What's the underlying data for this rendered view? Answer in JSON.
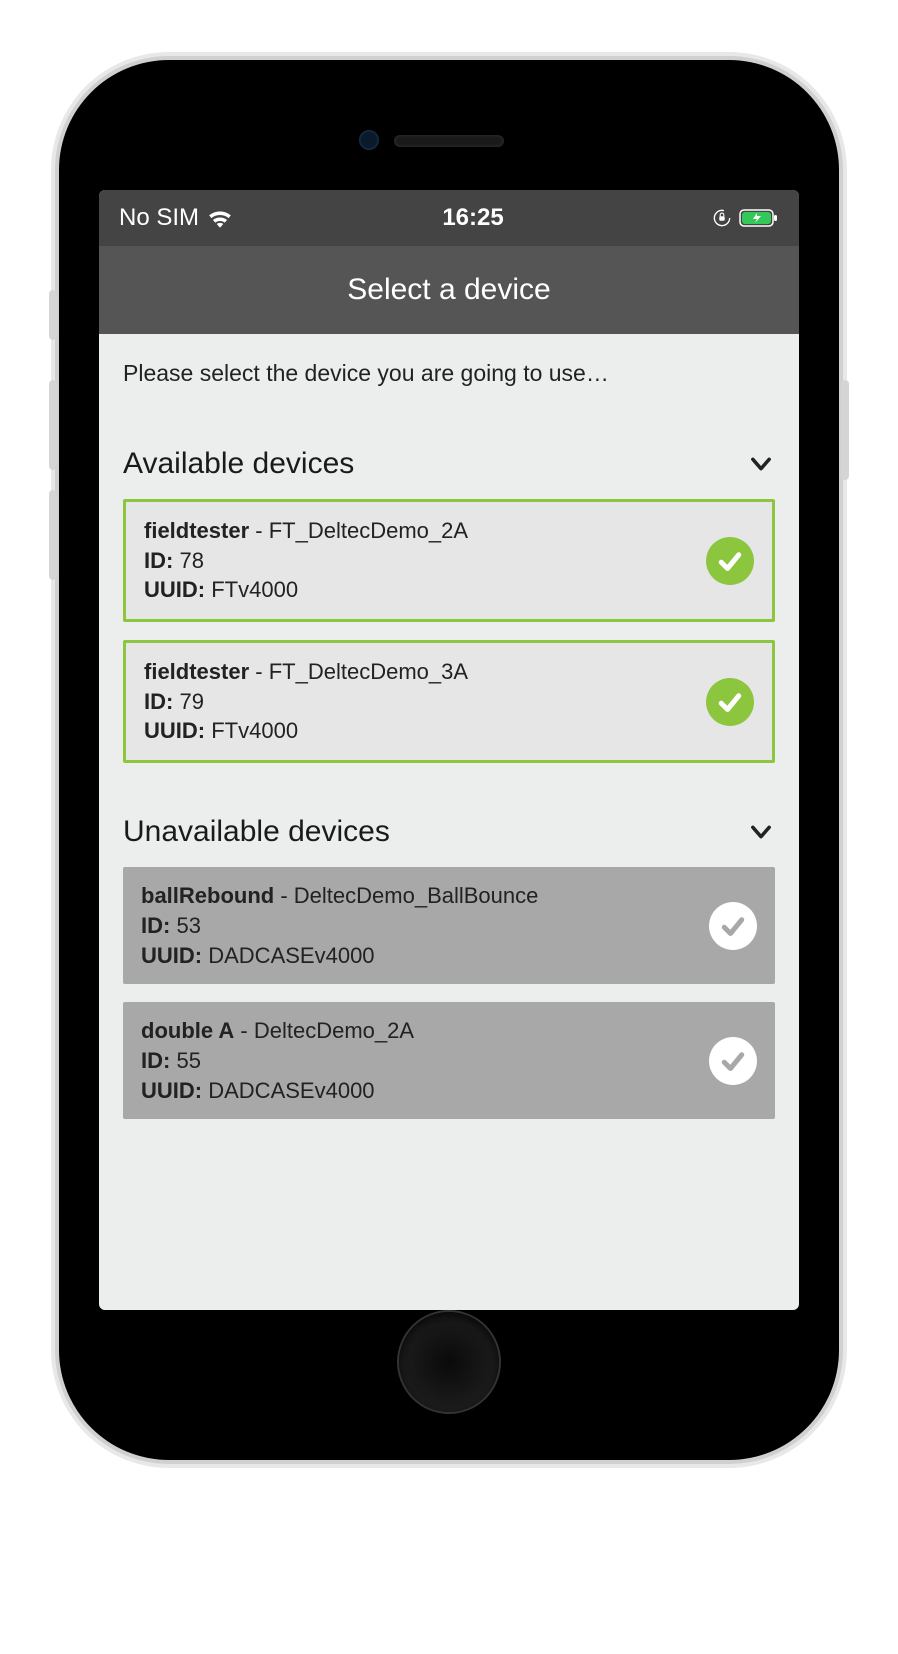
{
  "status_bar": {
    "carrier": "No SIM",
    "time": "16:25"
  },
  "header": {
    "title": "Select a device"
  },
  "content": {
    "instruction": "Please select the device you are going to use…"
  },
  "available_section": {
    "title": "Available devices",
    "devices": [
      {
        "type_label": "fieldtester",
        "name": "FT_DeltecDemo_2A",
        "id_label": "ID:",
        "id_value": "78",
        "uuid_label": "UUID:",
        "uuid_value": "FTv4000"
      },
      {
        "type_label": "fieldtester",
        "name": "FT_DeltecDemo_3A",
        "id_label": "ID:",
        "id_value": "79",
        "uuid_label": "UUID:",
        "uuid_value": "FTv4000"
      }
    ]
  },
  "unavailable_section": {
    "title": "Unavailable devices",
    "devices": [
      {
        "type_label": "ballRebound",
        "name": "DeltecDemo_BallBounce",
        "id_label": "ID:",
        "id_value": "53",
        "uuid_label": "UUID:",
        "uuid_value": "DADCASEv4000"
      },
      {
        "type_label": "double A",
        "name": "DeltecDemo_2A",
        "id_label": "ID:",
        "id_value": "55",
        "uuid_label": "UUID:",
        "uuid_value": "DADCASEv4000"
      }
    ]
  },
  "colors": {
    "accent_green": "#8cc63e",
    "header_bg": "#555555",
    "status_bg": "#444444"
  }
}
